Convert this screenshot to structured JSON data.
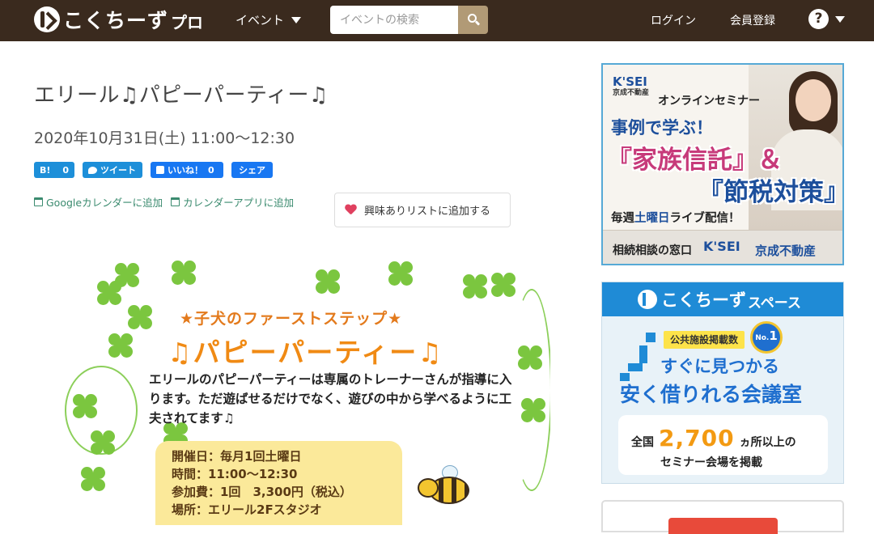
{
  "header": {
    "logo_text": "こくちーず",
    "logo_sub": "プロ",
    "nav_events": "イベント",
    "search_placeholder": "イベントの検索",
    "login": "ログイン",
    "register": "会員登録",
    "help": "?"
  },
  "event": {
    "title": "エリール♫パピーパーティー♫",
    "datetime": "2020年10月31日(土) 11:00～12:30"
  },
  "share": {
    "hatena": "B!",
    "hatena_count": "0",
    "tweet": "ツイート",
    "like": "いいね！",
    "like_count": "0",
    "share": "シェア"
  },
  "calendar": {
    "google": "Googleカレンダーに追加",
    "app": "カレンダーアプリに追加"
  },
  "favorite": {
    "label": "興味ありリストに追加する"
  },
  "flyer": {
    "subtitle": "★子犬のファーストステップ★",
    "title": "♫パピーパーティー♫",
    "description": "エリールのパピーパーティーは専属のトレーナーさんが指導に入ります。ただ遊ばせるだけでなく、遊びの中から学べるように工夫されてます♫",
    "info": [
      "開催日：毎月1回土曜日",
      "時間：11:00～12:30",
      "参加費：1回　3,300円（税込）",
      "場所：エリール2Fスタジオ"
    ]
  },
  "ads": {
    "ad1": {
      "brand": "K'SEI",
      "brand_sub": "京成不動産",
      "online": "オンラインセミナー",
      "line1": "事例で学ぶ！",
      "line2": "『家族信託』＆",
      "line3": "『節税対策』",
      "line4_pre": "毎週",
      "line4_em": "土曜日",
      "line4_post": "ライブ配信！",
      "foot_left": "相続相談の窓口",
      "foot_logo": "K'SEI",
      "foot_right": "京成不動産"
    },
    "ad2": {
      "brand": "こくちーず",
      "brand_sub": "スペース",
      "badge": "公共施設掲載数",
      "no1": "No.",
      "no1_num": "1",
      "line1": "すぐに見つかる",
      "line2": "安く借りれる会議室",
      "box_pre": "全国",
      "box_num": "2,700",
      "box_post": "ヵ所以上の",
      "box_line2": "セミナー会場を掲載"
    }
  },
  "colors": {
    "header_bg": "#3a2a1e",
    "search_btn": "#b19a76",
    "share_blue": "#1d8fd9",
    "facebook_blue": "#1877f2",
    "calendar_link": "#3b8b6f",
    "heart": "#e0405f"
  }
}
